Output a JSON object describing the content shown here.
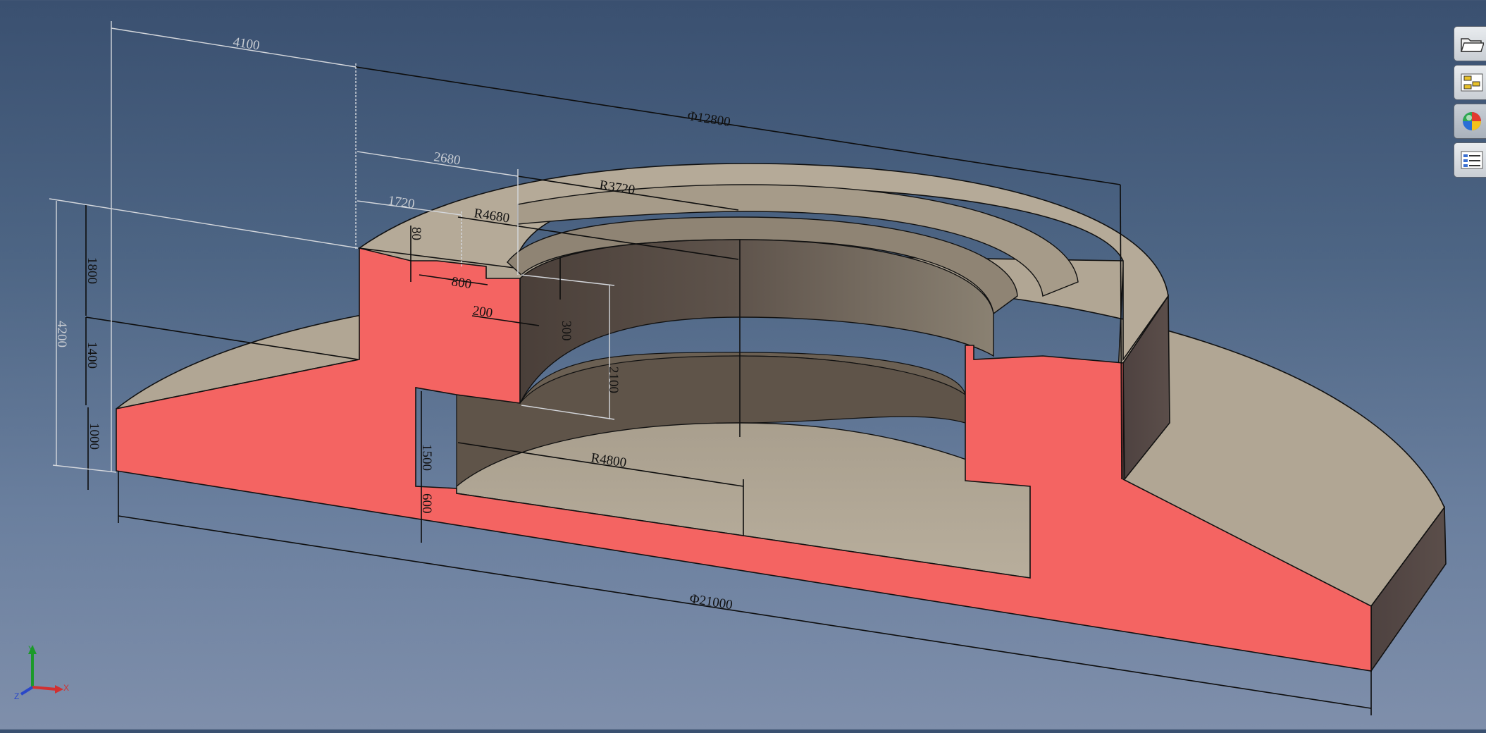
{
  "dimensions": {
    "top_diameter": "Φ12800",
    "bottom_diameter": "Φ21000",
    "offset_4100": "4100",
    "offset_2680": "2680",
    "offset_1720": "1720",
    "radius_3720": "R3720",
    "radius_4680": "R4680",
    "radius_4800": "R4800",
    "step_80": "80",
    "step_800": "800",
    "step_200": "200",
    "step_300": "300",
    "height_2100": "2100",
    "height_1800": "1800",
    "height_1400": "1400",
    "height_1000": "1000",
    "height_4200": "4200",
    "height_1500": "1500",
    "height_600": "600"
  },
  "axes": {
    "y": "Y",
    "x": "X",
    "z": "Z"
  },
  "toolbar": {
    "items": [
      {
        "name": "open-folder-icon"
      },
      {
        "name": "model-tree-icon"
      },
      {
        "name": "appearance-sphere-icon"
      },
      {
        "name": "properties-list-icon"
      }
    ]
  },
  "colors": {
    "section_cut": "#f46462",
    "concrete_top": "#b3a896",
    "concrete_inner": "#5a4e46",
    "background_top": "#3a5070",
    "background_bottom": "#7f8fab"
  }
}
